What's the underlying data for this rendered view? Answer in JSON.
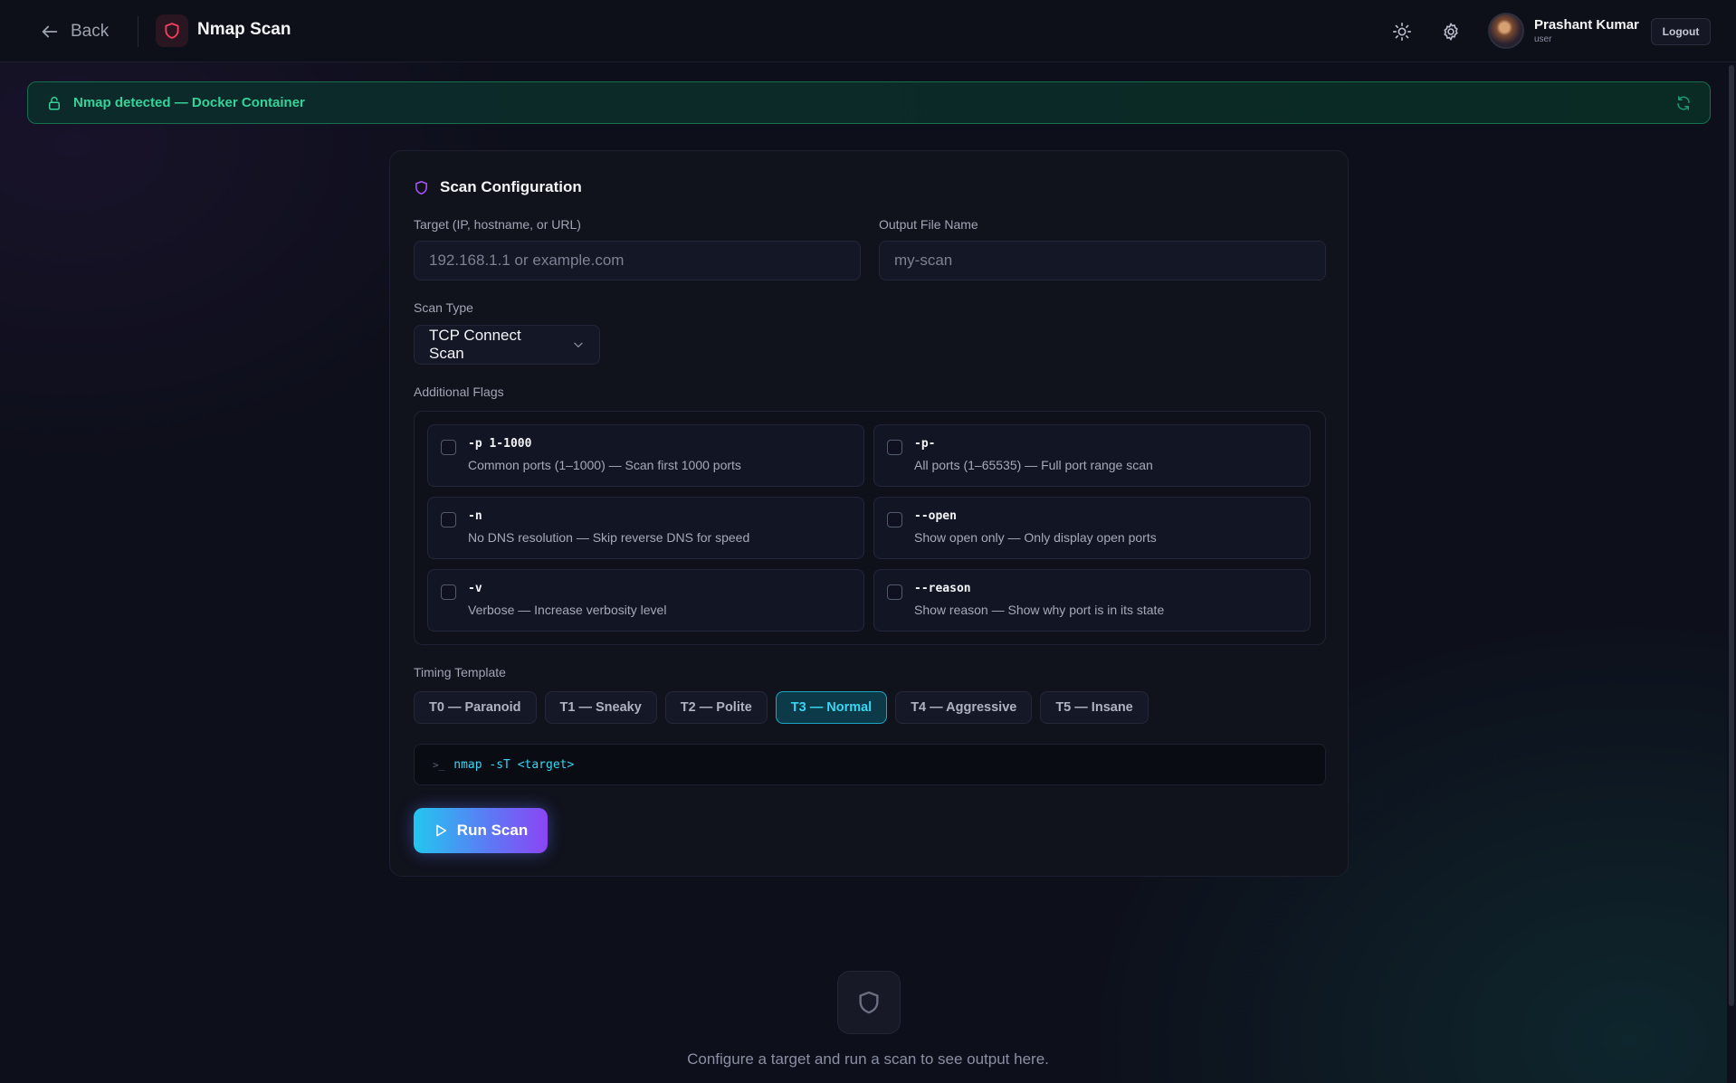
{
  "header": {
    "back_label": "Back",
    "app_title": "Nmap Scan",
    "user_name": "Prashant Kumar",
    "user_role": "user",
    "logout_label": "Logout"
  },
  "banner": {
    "text": "Nmap detected — Docker Container",
    "status_color": "#34d399"
  },
  "config": {
    "title": "Scan Configuration",
    "target_label": "Target (IP, hostname, or URL)",
    "target_placeholder": "192.168.1.1 or example.com",
    "target_value": "",
    "output_label": "Output File Name",
    "output_placeholder": "my-scan",
    "output_value": "",
    "scan_type_label": "Scan Type",
    "scan_type_value": "TCP Connect Scan",
    "flags_label": "Additional Flags",
    "flags": [
      {
        "flag": "-p 1-1000",
        "desc": "Common ports (1–1000) — Scan first 1000 ports",
        "checked": false
      },
      {
        "flag": "-p-",
        "desc": "All ports (1–65535) — Full port range scan",
        "checked": false
      },
      {
        "flag": "-n",
        "desc": "No DNS resolution — Skip reverse DNS for speed",
        "checked": false
      },
      {
        "flag": "--open",
        "desc": "Show open only — Only display open ports",
        "checked": false
      },
      {
        "flag": "-v",
        "desc": "Verbose — Increase verbosity level",
        "checked": false
      },
      {
        "flag": "--reason",
        "desc": "Show reason — Show why port is in its state",
        "checked": false
      }
    ],
    "timing_label": "Timing Template",
    "timing": [
      {
        "label": "T0 — Paranoid",
        "active": false
      },
      {
        "label": "T1 — Sneaky",
        "active": false
      },
      {
        "label": "T2 — Polite",
        "active": false
      },
      {
        "label": "T3 — Normal",
        "active": true
      },
      {
        "label": "T4 — Aggressive",
        "active": false
      },
      {
        "label": "T5 — Insane",
        "active": false
      }
    ],
    "command_prompt": ">_",
    "command": "nmap -sT <target>",
    "run_label": "Run Scan"
  },
  "empty_state": {
    "text": "Configure a target and run a scan to see output here."
  },
  "colors": {
    "background": "#0d0f1a",
    "accent_cyan": "#38d6f2",
    "accent_purple": "#8b45f3",
    "logo_red": "#f43f5e"
  }
}
